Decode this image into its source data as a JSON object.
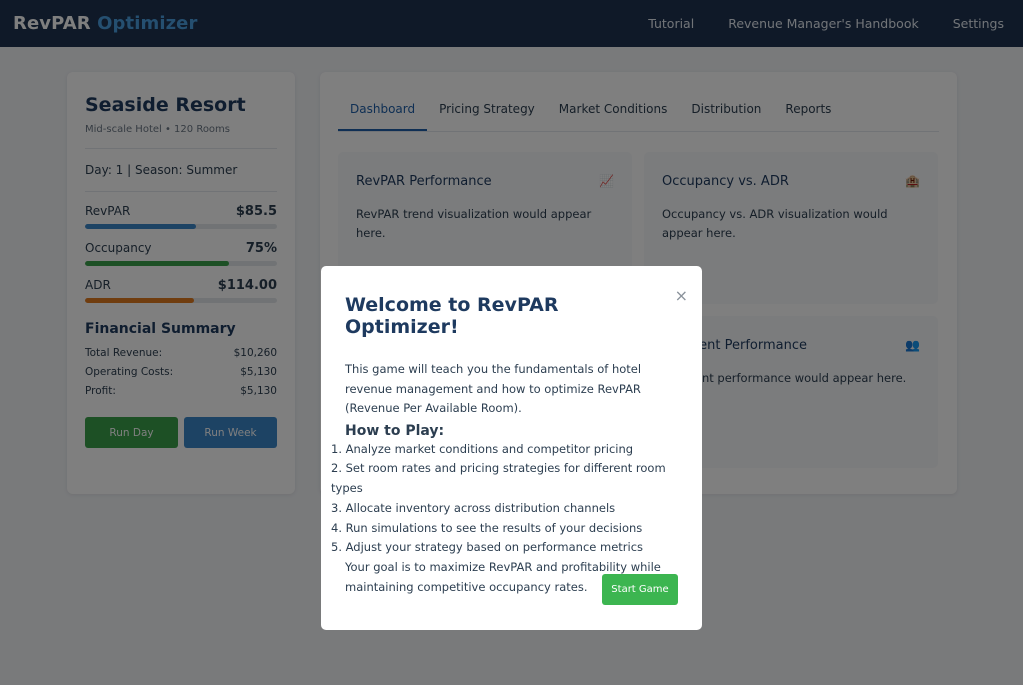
{
  "nav": {
    "logo_part1": "RevPAR",
    "logo_part2": "Optimizer",
    "links": [
      "Tutorial",
      "Revenue Manager's Handbook",
      "Settings"
    ]
  },
  "sidebar": {
    "hotel_name": "Seaside Resort",
    "hotel_sub": "Mid-scale Hotel • 120 Rooms",
    "day_line": "Day: 1 | Season: Summer",
    "metrics": [
      {
        "label": "RevPAR",
        "value": "$85.5",
        "level": 0.58,
        "color": "#3b86c8"
      },
      {
        "label": "Occupancy",
        "value": "75%",
        "level": 0.75,
        "color": "#3aa04a"
      },
      {
        "label": "ADR",
        "value": "$114.00",
        "level": 0.57,
        "color": "#e07b1f"
      }
    ],
    "financial_title": "Financial Summary",
    "financial": [
      {
        "label": "Total Revenue:",
        "value": "$10,260"
      },
      {
        "label": "Operating Costs:",
        "value": "$5,130"
      },
      {
        "label": "Profit:",
        "value": "$5,130"
      }
    ],
    "run_day": "Run Day",
    "run_week": "Run Week"
  },
  "main": {
    "tabs": [
      "Dashboard",
      "Pricing Strategy",
      "Market Conditions",
      "Distribution",
      "Reports"
    ],
    "active_tab": 0,
    "cards": [
      {
        "title": "RevPAR Performance",
        "icon": "chart-icon",
        "glyph": "📈",
        "text": "RevPAR trend visualization would appear here."
      },
      {
        "title": "Occupancy vs. ADR",
        "icon": "hotel-icon",
        "glyph": "🏨",
        "text": "Occupancy vs. ADR visualization would appear here."
      },
      {
        "title": "",
        "icon": "",
        "glyph": "",
        "text": ""
      },
      {
        "title": "Segment Performance",
        "icon": "people-icon",
        "glyph": "👥",
        "text": "Segment performance would appear here."
      }
    ]
  },
  "modal": {
    "title": "Welcome to RevPAR Optimizer!",
    "close": "×",
    "intro": "This game will teach you the fundamentals of hotel revenue management and how to optimize RevPAR (Revenue Per Available Room).",
    "how_title": "How to Play:",
    "steps": [
      "1. Analyze market conditions and competitor pricing",
      "2. Set room rates and pricing strategies for different room types",
      "3. Allocate inventory across distribution channels",
      "4. Run simulations to see the results of your decisions",
      "5. Adjust your strategy based on performance metrics"
    ],
    "goal": "Your goal is to maximize RevPAR and profitability while maintaining competitive occupancy rates.",
    "start": "Start Game"
  }
}
